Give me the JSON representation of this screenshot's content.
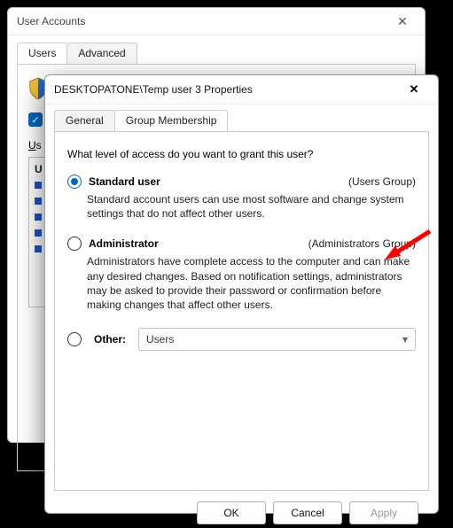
{
  "back_window": {
    "title": "User Accounts",
    "tabs": [
      "Users",
      "Advanced"
    ],
    "active_tab": 0,
    "checkbox_checked": true,
    "list_label_html": "Users for this computer:"
  },
  "front_window": {
    "title": "DESKTOPATONE\\Temp user 3 Properties",
    "tabs": [
      "General",
      "Group Membership"
    ],
    "active_tab": 1,
    "question": "What level of access do you want to grant this user?",
    "options": {
      "standard": {
        "label": "Standard user",
        "group": "(Users Group)",
        "description": "Standard account users can use most software and change system settings that do not affect other users.",
        "selected": true
      },
      "administrator": {
        "label": "Administrator",
        "group": "(Administrators Group)",
        "description": "Administrators have complete access to the computer and can make any desired changes. Based on notification settings, administrators may be asked to provide their password or confirmation before making changes that affect other users.",
        "selected": false
      },
      "other": {
        "label": "Other:",
        "value": "Users",
        "selected": false
      }
    },
    "buttons": {
      "ok": "OK",
      "cancel": "Cancel",
      "apply": "Apply"
    }
  },
  "annotation": {
    "arrow": "red-arrow"
  }
}
